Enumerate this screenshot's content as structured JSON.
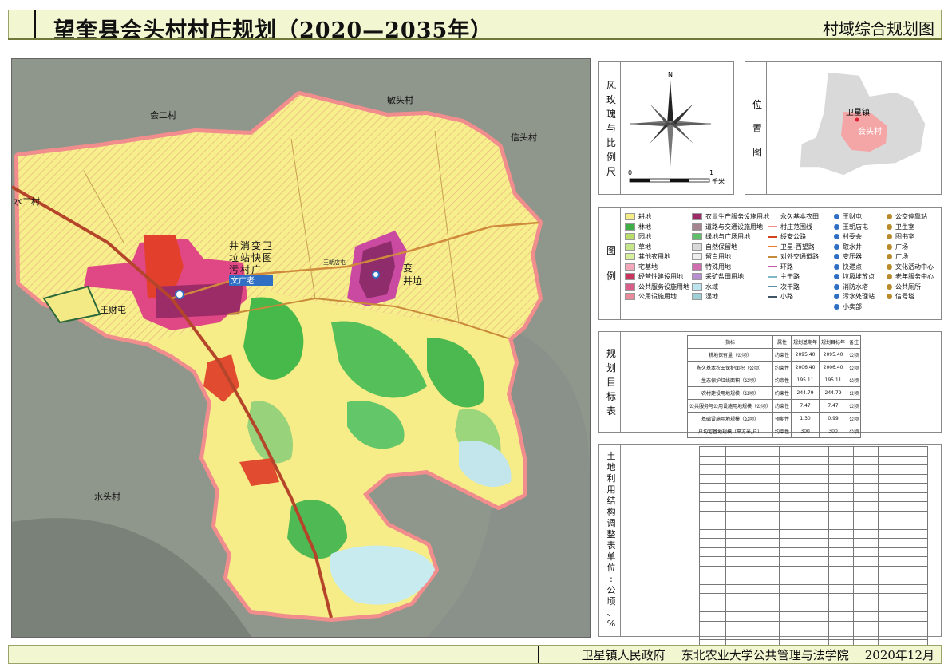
{
  "header": {
    "title": "望奎县会头村村庄规划（2020—2035年）",
    "sheet_name": "村域综合规划图"
  },
  "map": {
    "labels": {
      "huier": "会二村",
      "dunou": "敏头村",
      "xintou": "信头村",
      "shuier": "水二村",
      "shuitou": "水头村",
      "wangcai": "王财屯",
      "wangshu": "王朝店屯",
      "bian_jing_la_left": [
        "井",
        "垃",
        "污"
      ],
      "facilities_col2": [
        "消",
        "站",
        "村"
      ],
      "facilities_col3": [
        "变",
        "快",
        "广"
      ],
      "facilities_col4": [
        "卫",
        "图"
      ],
      "wen_guang_lao": "文广老",
      "right_group_1": "变",
      "right_group_2": "井垃"
    },
    "colors": {
      "background": "#8d9388",
      "farmland": "#f7ee8c",
      "forest": "#47b84a",
      "grass": "#9ad373",
      "village": "#e23d7e",
      "industry": "#e14b2f",
      "water": "#bfe7ec",
      "boundary": "#f08b8b",
      "road": "#c76e2a"
    }
  },
  "compass": {
    "label": [
      "风",
      "玫",
      "瑰",
      "与",
      "比",
      "例",
      "尺"
    ],
    "north": "N",
    "scale_0": "0",
    "scale_1": "1",
    "scale_unit": "千米"
  },
  "location": {
    "label": [
      "位",
      "置",
      "图"
    ],
    "town": "卫星镇",
    "village": "会头村"
  },
  "legend": {
    "label": [
      "图",
      "例"
    ],
    "col1": [
      {
        "name": "耕地",
        "color": "#f4ec85"
      },
      {
        "name": "林地",
        "color": "#3fae47"
      },
      {
        "name": "园地",
        "color": "#b8dd6b"
      },
      {
        "name": "草地",
        "color": "#c5e68a"
      },
      {
        "name": "其他农用地",
        "color": "#d7ef9a"
      },
      {
        "name": "宅基地",
        "color": "#f2a8b8"
      },
      {
        "name": "经营性建设用地",
        "color": "#c9345c"
      },
      {
        "name": "公共服务设施用地",
        "color": "#d85f8a"
      },
      {
        "name": "公用设施用地",
        "color": "#e88a9a"
      }
    ],
    "col2": [
      {
        "name": "农业生产服务设施用地",
        "color": "#9b2b66"
      },
      {
        "name": "道路与交通设施用地",
        "color": "#a48690"
      },
      {
        "name": "绿地与广场用地",
        "color": "#5fbf6a"
      },
      {
        "name": "自然保留地",
        "color": "#d9d9d9"
      },
      {
        "name": "留白用地",
        "color": "#eeeeee"
      },
      {
        "name": "特殊用地",
        "color": "#d06fb0"
      },
      {
        "name": "采矿盐田用地",
        "color": "#b88fd0"
      },
      {
        "name": "水域",
        "color": "#bde3ee"
      },
      {
        "name": "湿地",
        "color": "#9fd0d6"
      }
    ],
    "col3": [
      {
        "name": "永久基本农田",
        "color": "#ffffff"
      },
      {
        "name": "村庄范围线",
        "color": "#f08b8b"
      },
      {
        "name": "绥安公路",
        "color": "#d2421c"
      },
      {
        "name": "卫星-西望路",
        "color": "#ef7d2c"
      },
      {
        "name": "对外交通道路",
        "color": "#c48b3a"
      },
      {
        "name": "环路",
        "color": "#c65aa4"
      },
      {
        "name": "主干路",
        "color": "#7fb8c7"
      },
      {
        "name": "次干路",
        "color": "#5c8fa4"
      },
      {
        "name": "小路",
        "color": "#405466"
      }
    ],
    "col4_icons": [
      "王财屯",
      "王朝店屯",
      "村委会",
      "取水井",
      "变压器",
      "快递点",
      "垃圾堆放点",
      "消防水塔",
      "污水处理站",
      "小卖部"
    ],
    "col5_icons": [
      "公交停靠站",
      "卫生室",
      "图书室",
      "广场",
      "广场",
      "文化活动中心",
      "老年服务中心",
      "公共厕所",
      "信号塔"
    ]
  },
  "targets": {
    "label": [
      "规",
      "划",
      "目",
      "标",
      "表"
    ],
    "headers": [
      "指标",
      "属性",
      "规划基期年",
      "规划目标年",
      "备注"
    ],
    "rows": [
      [
        "耕地保有量（公顷）",
        "约束性",
        "2095.40",
        "2095.40",
        "公顷"
      ],
      [
        "永久基本农田保护面积（公顷）",
        "约束性",
        "2006.40",
        "2006.40",
        "公顷"
      ],
      [
        "生态保护红线面积（公顷）",
        "约束性",
        "195.11",
        "195.11",
        "公顷"
      ],
      [
        "农村建设用地规模（公顷）",
        "约束性",
        "244.79",
        "244.79",
        "公顷"
      ],
      [
        "公共服务与公用设施用地规模（公顷）",
        "约束性",
        "7.47",
        "7.47",
        "公顷"
      ],
      [
        "基础设施用地规模（公顷）",
        "预期性",
        "1.30",
        "0.99",
        "公顷"
      ],
      [
        "户均宅基地规模（平方米/户）",
        "约束性",
        "300",
        "300",
        "公顷"
      ]
    ]
  },
  "landuse": {
    "label": [
      "土",
      "地",
      "利",
      "用",
      "结",
      "构",
      "调",
      "整",
      "表",
      "单",
      "位",
      ":",
      "公",
      "顷",
      "、",
      "%"
    ],
    "rows": 22
  },
  "footer": {
    "org1": "卫星镇人民政府",
    "org2": "东北农业大学公共管理与法学院",
    "date": "2020年12月"
  }
}
